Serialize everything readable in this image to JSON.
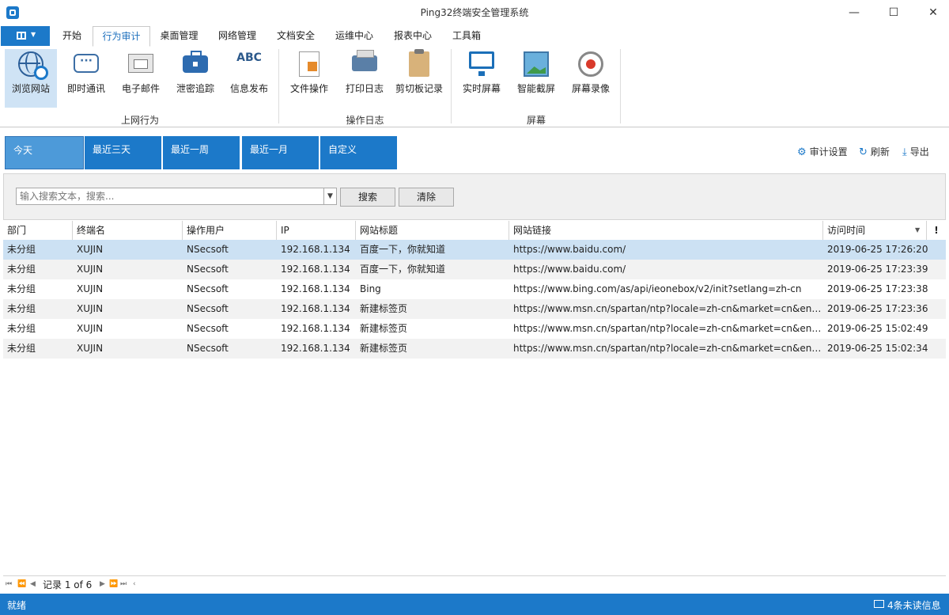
{
  "window": {
    "title": "Ping32终端安全管理系统",
    "minimize": "—",
    "maximize": "☐",
    "close": "✕"
  },
  "menu": {
    "tabs": [
      {
        "label": "开始"
      },
      {
        "label": "行为审计"
      },
      {
        "label": "桌面管理"
      },
      {
        "label": "网络管理"
      },
      {
        "label": "文档安全"
      },
      {
        "label": "运维中心"
      },
      {
        "label": "报表中心"
      },
      {
        "label": "工具箱"
      }
    ],
    "active_tab": "行为审计"
  },
  "ribbon": {
    "groups": [
      {
        "label": "上网行为",
        "buttons": [
          "浏览网站",
          "即时通讯",
          "电子邮件",
          "泄密追踪",
          "信息发布"
        ]
      },
      {
        "label": "操作日志",
        "buttons": [
          "文件操作",
          "打印日志",
          "剪切板记录"
        ]
      },
      {
        "label": "屏幕",
        "buttons": [
          "实时屏幕",
          "智能截屏",
          "屏幕录像"
        ]
      }
    ],
    "abc_text": "ABC",
    "selected": "浏览网站"
  },
  "ranges": [
    "今天",
    "最近三天",
    "最近一周",
    "最近一月",
    "自定义"
  ],
  "toolbar": {
    "audit_settings": "审计设置",
    "refresh": "刷新",
    "export": "导出"
  },
  "search": {
    "placeholder": "输入搜索文本，搜索...",
    "search_btn": "搜索",
    "clear_btn": "清除"
  },
  "table": {
    "columns": [
      "部门",
      "终端名",
      "操作用户",
      "IP",
      "网站标题",
      "网站链接",
      "访问时间"
    ],
    "rows": [
      [
        "未分组",
        "XUJIN",
        "NSecsoft",
        "192.168.1.134",
        "百度一下，你就知道",
        "https://www.baidu.com/",
        "2019-06-25 17:26:20"
      ],
      [
        "未分组",
        "XUJIN",
        "NSecsoft",
        "192.168.1.134",
        "百度一下，你就知道",
        "https://www.baidu.com/",
        "2019-06-25 17:23:39"
      ],
      [
        "未分组",
        "XUJIN",
        "NSecsoft",
        "192.168.1.134",
        "Bing",
        "https://www.bing.com/as/api/ieonebox/v2/init?setlang=zh-cn",
        "2019-06-25 17:23:38"
      ],
      [
        "未分组",
        "XUJIN",
        "NSecsoft",
        "192.168.1.134",
        "新建标签页",
        "https://www.msn.cn/spartan/ntp?locale=zh-cn&market=cn&enab...",
        "2019-06-25 17:23:36"
      ],
      [
        "未分组",
        "XUJIN",
        "NSecsoft",
        "192.168.1.134",
        "新建标签页",
        "https://www.msn.cn/spartan/ntp?locale=zh-cn&market=cn&enab...",
        "2019-06-25 15:02:49"
      ],
      [
        "未分组",
        "XUJIN",
        "NSecsoft",
        "192.168.1.134",
        "新建标签页",
        "https://www.msn.cn/spartan/ntp?locale=zh-cn&market=cn&enab...",
        "2019-06-25 15:02:34"
      ]
    ]
  },
  "pager": {
    "record_text": "记录 1 of 6"
  },
  "status": {
    "left": "就绪",
    "right": "4条未读信息"
  },
  "colors": {
    "accent": "#1c79c9",
    "selected_row": "#cce1f3"
  }
}
